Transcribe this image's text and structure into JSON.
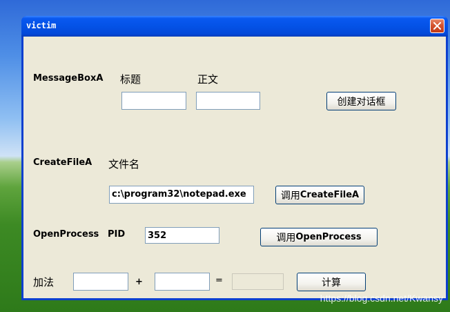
{
  "window": {
    "title": "victim"
  },
  "messagebox": {
    "section_label": "MessageBoxA",
    "title_label": "标题",
    "body_label": "正文",
    "title_value": "",
    "body_value": "",
    "button_label": "创建对话框"
  },
  "createfile": {
    "section_label": "CreateFileA",
    "filename_label": "文件名",
    "filename_value": "c:\\program32\\notepad.exe",
    "button_prefix": "调用",
    "button_api": "CreateFileA"
  },
  "openprocess": {
    "section_label": "OpenProcess",
    "pid_label": "PID",
    "pid_value": "352",
    "button_prefix": "调用",
    "button_api": "OpenProcess"
  },
  "add": {
    "label": "加法",
    "operand1": "",
    "plus": "+",
    "operand2": "",
    "equals": "=",
    "result": "",
    "button_label": "计算"
  },
  "watermark": "https://blog.csdn.net/Kwansy"
}
